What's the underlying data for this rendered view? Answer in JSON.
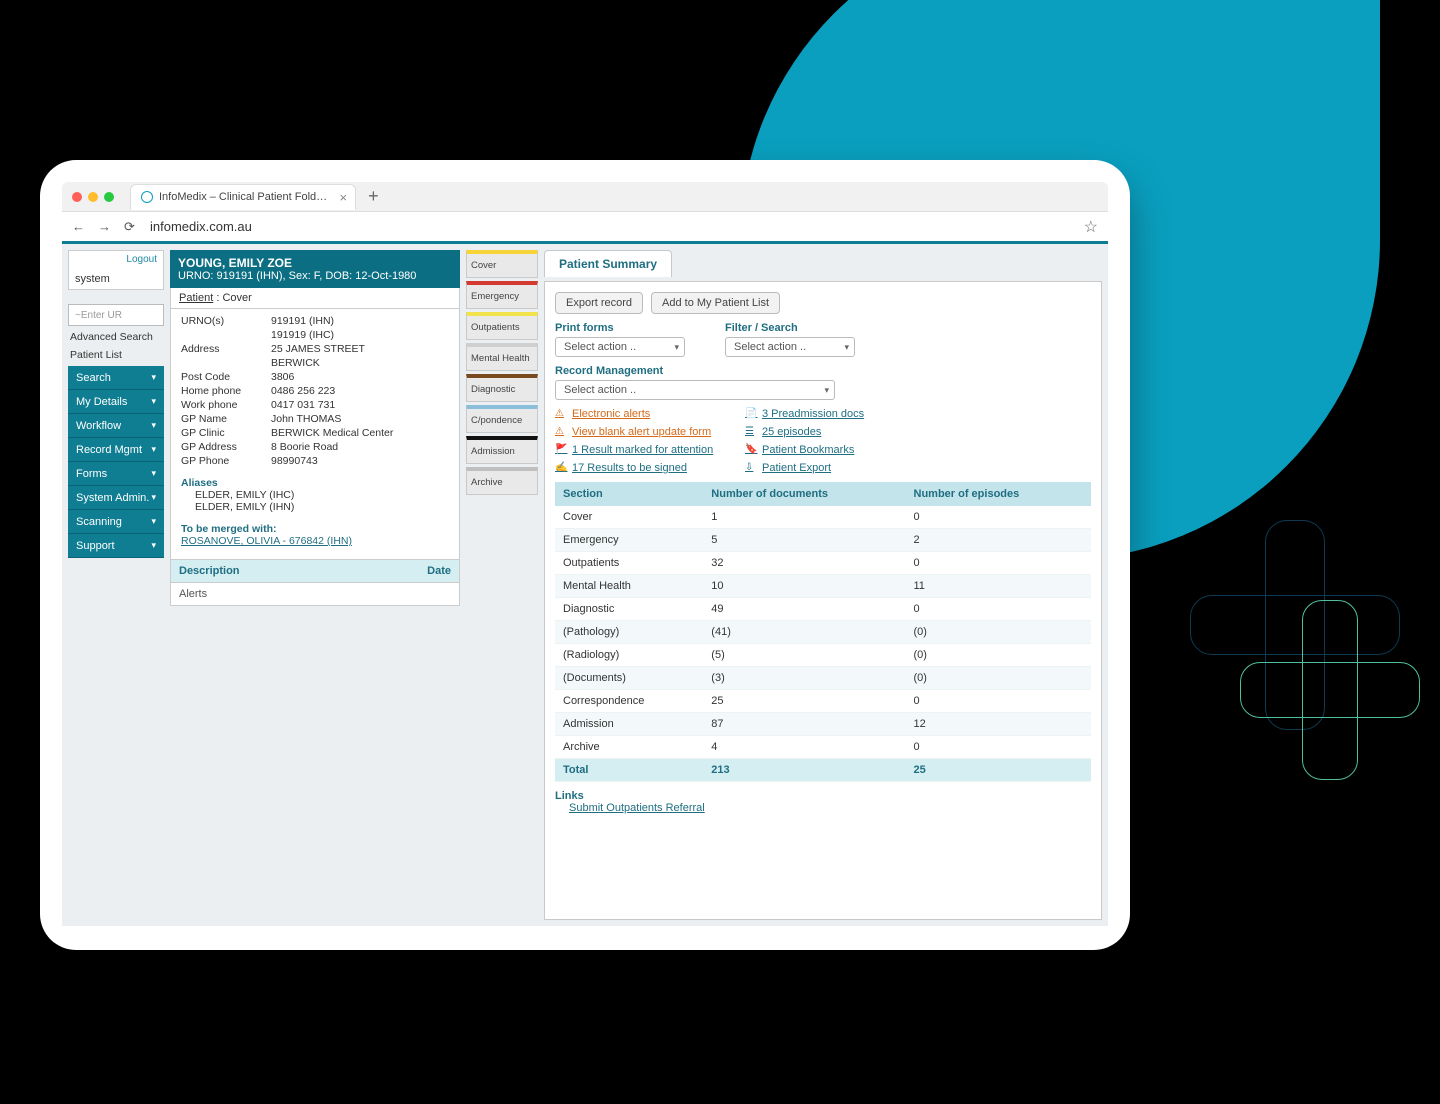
{
  "browser": {
    "tab_title": "InfoMedix – Clinical Patient Fold…",
    "url": "infomedix.com.au"
  },
  "sidebar": {
    "logout": "Logout",
    "system_label": "system",
    "ur_placeholder": "~Enter UR",
    "adv_search": "Advanced Search",
    "patient_list": "Patient List",
    "menu": [
      "Search",
      "My Details",
      "Workflow",
      "Record Mgmt",
      "Forms",
      "System Admin.",
      "Scanning",
      "Support"
    ]
  },
  "patient": {
    "name": "YOUNG, EMILY ZOE",
    "banner": "URNO: 919191 (IHN), Sex: F, DOB: 12-Oct-1980",
    "breadcrumb_patient": "Patient",
    "breadcrumb_cover": "Cover",
    "fields": {
      "urnos_label": "URNO(s)",
      "urno1": "919191 (IHN)",
      "urno2": "191919 (IHC)",
      "address_label": "Address",
      "address1": "25 JAMES STREET",
      "address2": "BERWICK",
      "postcode_label": "Post Code",
      "postcode": "3806",
      "homephone_label": "Home phone",
      "homephone": "0486 256 223",
      "workphone_label": "Work phone",
      "workphone": "0417 031 731",
      "gpname_label": "GP Name",
      "gpname": "John THOMAS",
      "gpclinic_label": "GP Clinic",
      "gpclinic": "BERWICK Medical Center",
      "gpaddress_label": "GP Address",
      "gpaddress": "8 Boorie Road",
      "gpphone_label": "GP Phone",
      "gpphone": "98990743"
    },
    "aliases_label": "Aliases",
    "alias1": "ELDER, EMILY  (IHC)",
    "alias2": "ELDER, EMILY  (IHN)",
    "merge_label": "To be merged with:",
    "merge_link": "ROSANOVE, OLIVIA - 676842 (IHN)",
    "desc_label": "Description",
    "date_label": "Date",
    "alerts_label": "Alerts"
  },
  "cat_tabs": [
    {
      "label": "Cover",
      "color": "#f7d538"
    },
    {
      "label": "Emergency",
      "color": "#d33a2f"
    },
    {
      "label": "Outpatients",
      "color": "#f2e24b"
    },
    {
      "label": "Mental Health",
      "color": "#cfcfcf"
    },
    {
      "label": "Diagnostic",
      "color": "#7a4a1e"
    },
    {
      "label": "C/pondence",
      "color": "#8bbedb"
    },
    {
      "label": "Admission",
      "color": "#111111"
    },
    {
      "label": "Archive",
      "color": "#bfbfbf"
    }
  ],
  "summary": {
    "tab": "Patient Summary",
    "export_btn": "Export record",
    "add_btn": "Add to My Patient List",
    "print_label": "Print forms",
    "filter_label": "Filter / Search",
    "record_label": "Record Management",
    "select_placeholder": "Select action ..",
    "links": {
      "alerts": "Electronic alerts",
      "preadm": "3 Preadmission docs",
      "blank_form": "View blank alert update form",
      "episodes": "25 episodes",
      "marked": "1 Result marked for attention",
      "bookmarks": "Patient Bookmarks",
      "tosign": "17 Results to be signed",
      "export": "Patient Export"
    },
    "table": {
      "headers": [
        "Section",
        "Number of documents",
        "Number of episodes"
      ],
      "rows": [
        {
          "section": "Cover",
          "docs": "1",
          "eps": "0"
        },
        {
          "section": "Emergency",
          "docs": "5",
          "eps": "2"
        },
        {
          "section": "Outpatients",
          "docs": "32",
          "eps": "0"
        },
        {
          "section": "Mental Health",
          "docs": "10",
          "eps": "11"
        },
        {
          "section": "Diagnostic",
          "docs": "49",
          "eps": "0"
        },
        {
          "section": "(Pathology)",
          "docs": "(41)",
          "eps": "(0)"
        },
        {
          "section": "(Radiology)",
          "docs": "(5)",
          "eps": "(0)"
        },
        {
          "section": "(Documents)",
          "docs": "(3)",
          "eps": "(0)"
        },
        {
          "section": "Correspondence",
          "docs": "25",
          "eps": "0"
        },
        {
          "section": "Admission",
          "docs": "87",
          "eps": "12"
        },
        {
          "section": "Archive",
          "docs": "4",
          "eps": "0"
        }
      ],
      "total": {
        "label": "Total",
        "docs": "213",
        "eps": "25"
      }
    },
    "links_label": "Links",
    "referral_link": "Submit Outpatients Referral"
  }
}
